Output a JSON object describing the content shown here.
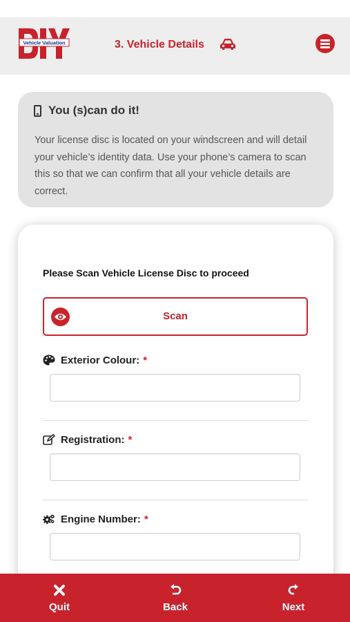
{
  "header": {
    "logo_text": "DIY",
    "logo_banner": "Vehicle Valuation",
    "title": "3. Vehicle Details"
  },
  "info_card": {
    "title": "You (s)can do it!",
    "text": "Your license disc is located on your windscreen and will detail your vehicle’s identity data. Use your phone’s camera to scan this so that we can confirm that all your vehicle details are correct."
  },
  "form": {
    "scan_prompt": "Please Scan Vehicle License Disc to proceed",
    "scan_button_label": "Scan",
    "fields": [
      {
        "label": "Exterior Colour:",
        "required_mark": "*",
        "value": "",
        "icon": "palette-icon"
      },
      {
        "label": "Registration:",
        "required_mark": "*",
        "value": "",
        "icon": "edit-icon"
      },
      {
        "label": "Engine Number:",
        "required_mark": "*",
        "value": "",
        "icon": "gears-icon"
      }
    ]
  },
  "bottom_nav": {
    "quit_label": "Quit",
    "back_label": "Back",
    "next_label": "Next"
  },
  "colors": {
    "brand_red": "#c8232c",
    "header_bg": "#eeeeee",
    "info_bg": "#e3e3e3"
  }
}
